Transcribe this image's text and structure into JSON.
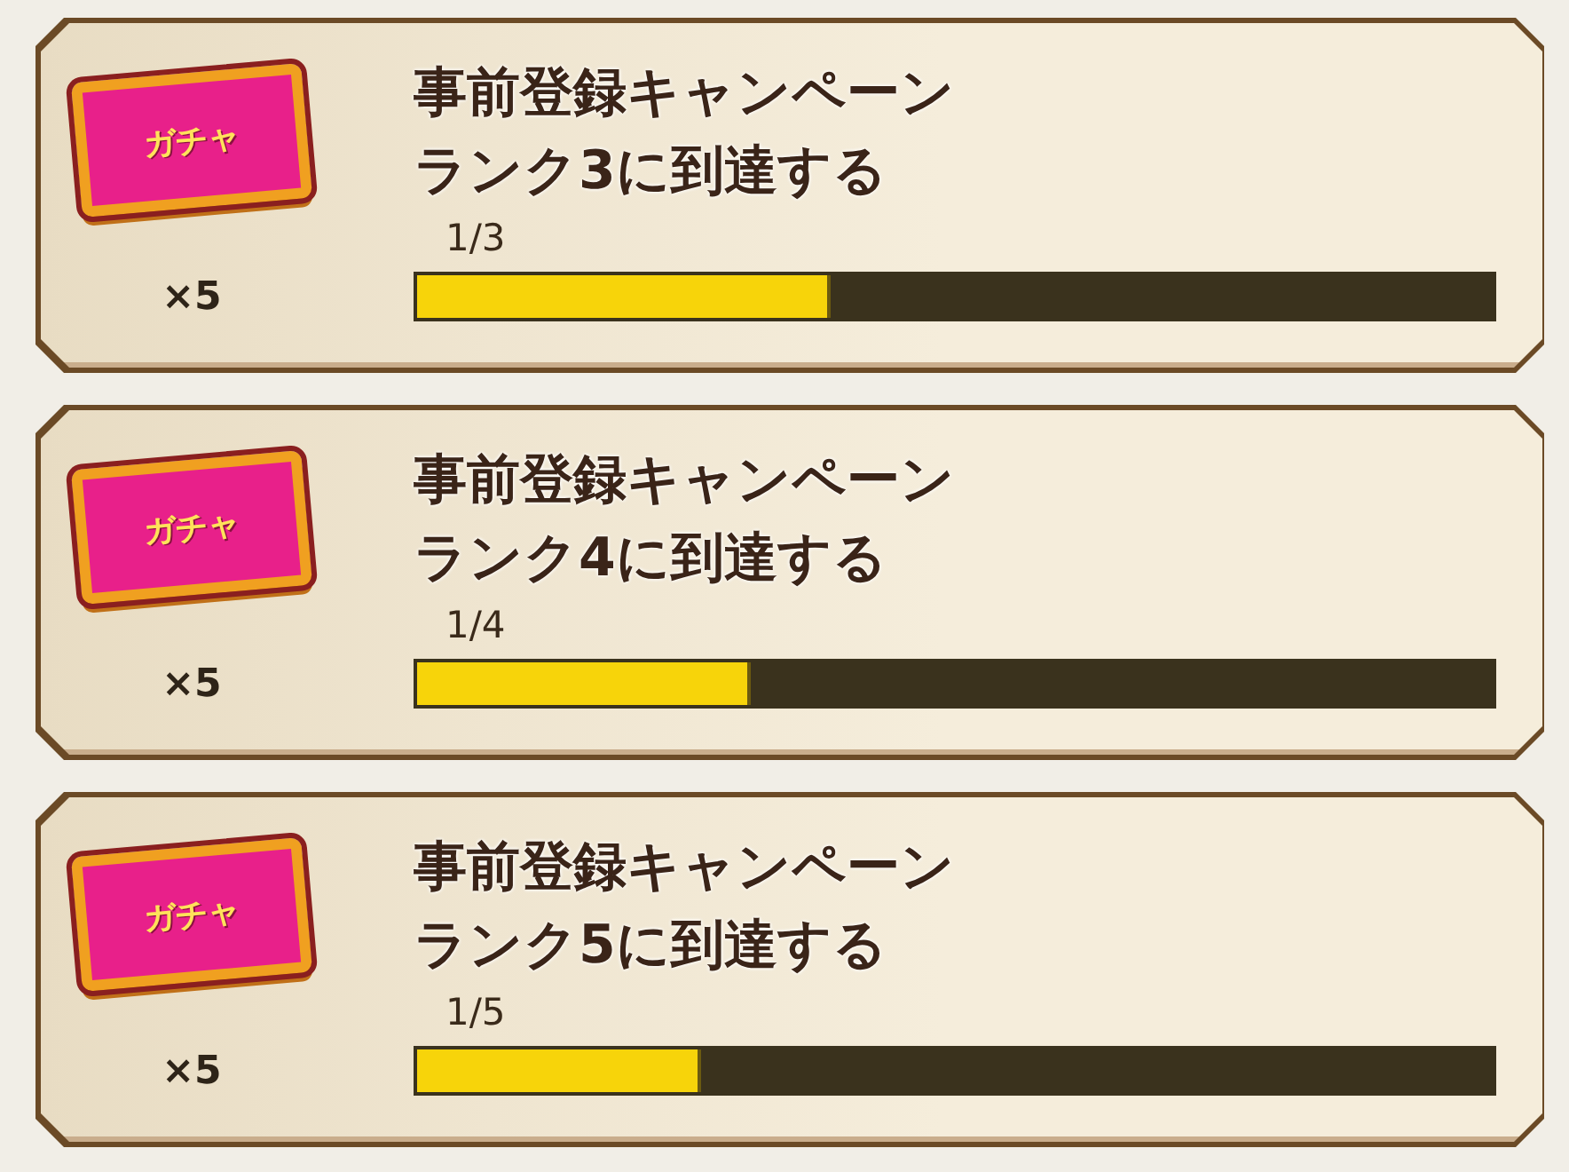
{
  "missions": [
    {
      "reward": {
        "ticket_label": "ガチャ",
        "quantity": "×5"
      },
      "title": "事前登録キャンペーン",
      "subtitle": "ランク3に到達する",
      "progress_text": "1/3",
      "level": 0.385
    },
    {
      "reward": {
        "ticket_label": "ガチャ",
        "quantity": "×5"
      },
      "title": "事前登録キャンペーン",
      "subtitle": "ランク4に到達する",
      "progress_text": "1/4",
      "level": 0.31
    },
    {
      "reward": {
        "ticket_label": "ガチャ",
        "quantity": "×5"
      },
      "title": "事前登録キャンペーン",
      "subtitle": "ランク5に到達する",
      "progress_text": "1/5",
      "level": 0.264
    }
  ]
}
